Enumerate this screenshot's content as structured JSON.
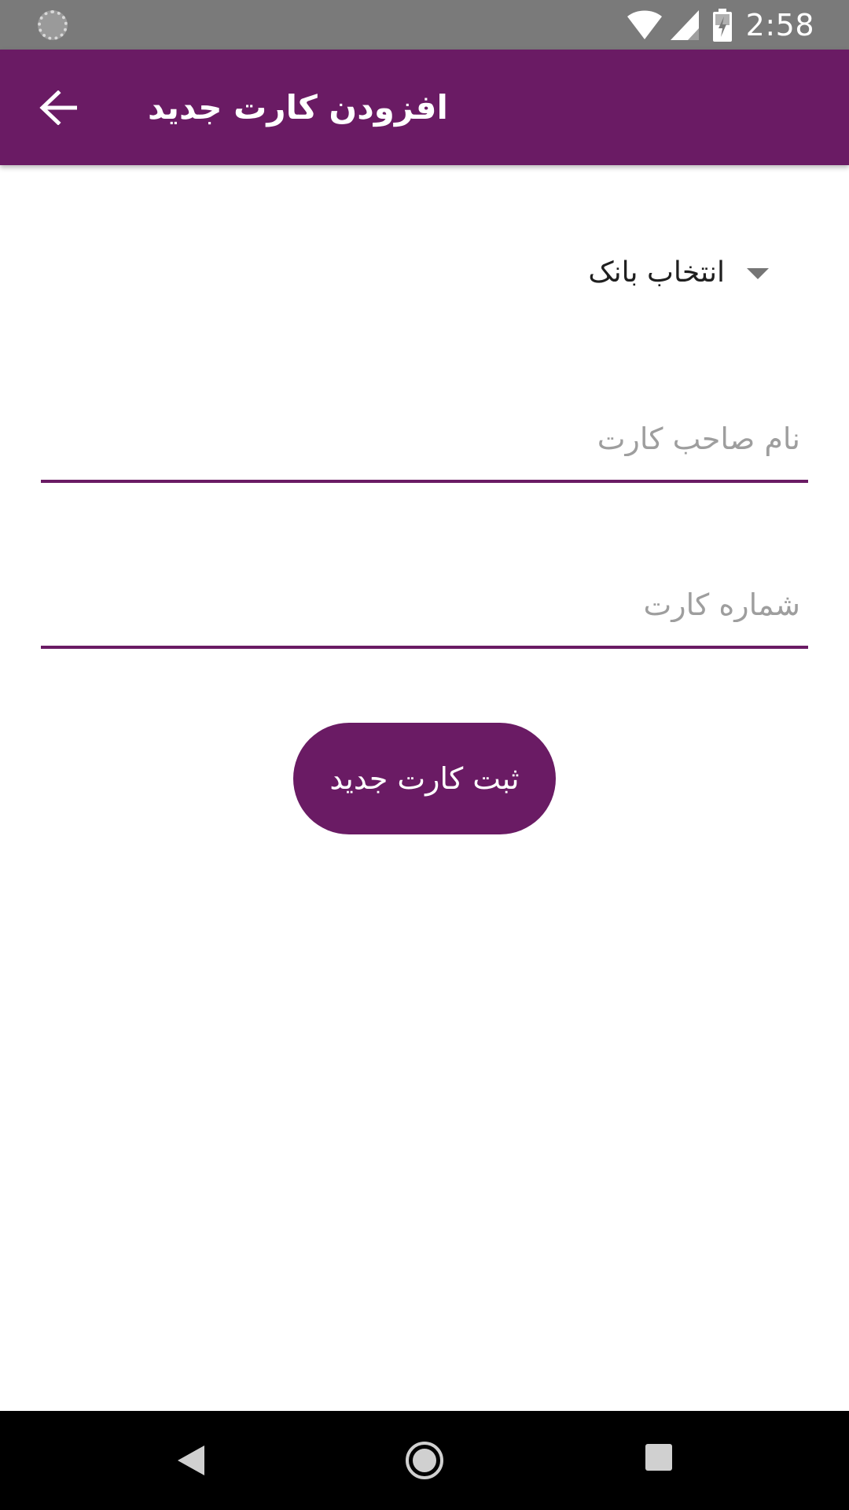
{
  "status_bar": {
    "time": "2:58",
    "icons": [
      "loading-icon",
      "wifi-icon",
      "signal-icon",
      "battery-charging-icon"
    ]
  },
  "app_bar": {
    "title": "افزودن کارت جدید",
    "back_icon": "arrow-back-icon",
    "background_color": "#6a1b64"
  },
  "form": {
    "bank_spinner": {
      "selected": "انتخاب بانک"
    },
    "card_holder": {
      "placeholder": "نام صاحب کارت",
      "value": ""
    },
    "card_number": {
      "placeholder": "شماره کارت",
      "value": ""
    },
    "submit_label": "ثبت کارت جدید"
  },
  "nav_bar": {
    "icons": [
      "nav-back-icon",
      "nav-home-icon",
      "nav-recents-icon"
    ]
  }
}
